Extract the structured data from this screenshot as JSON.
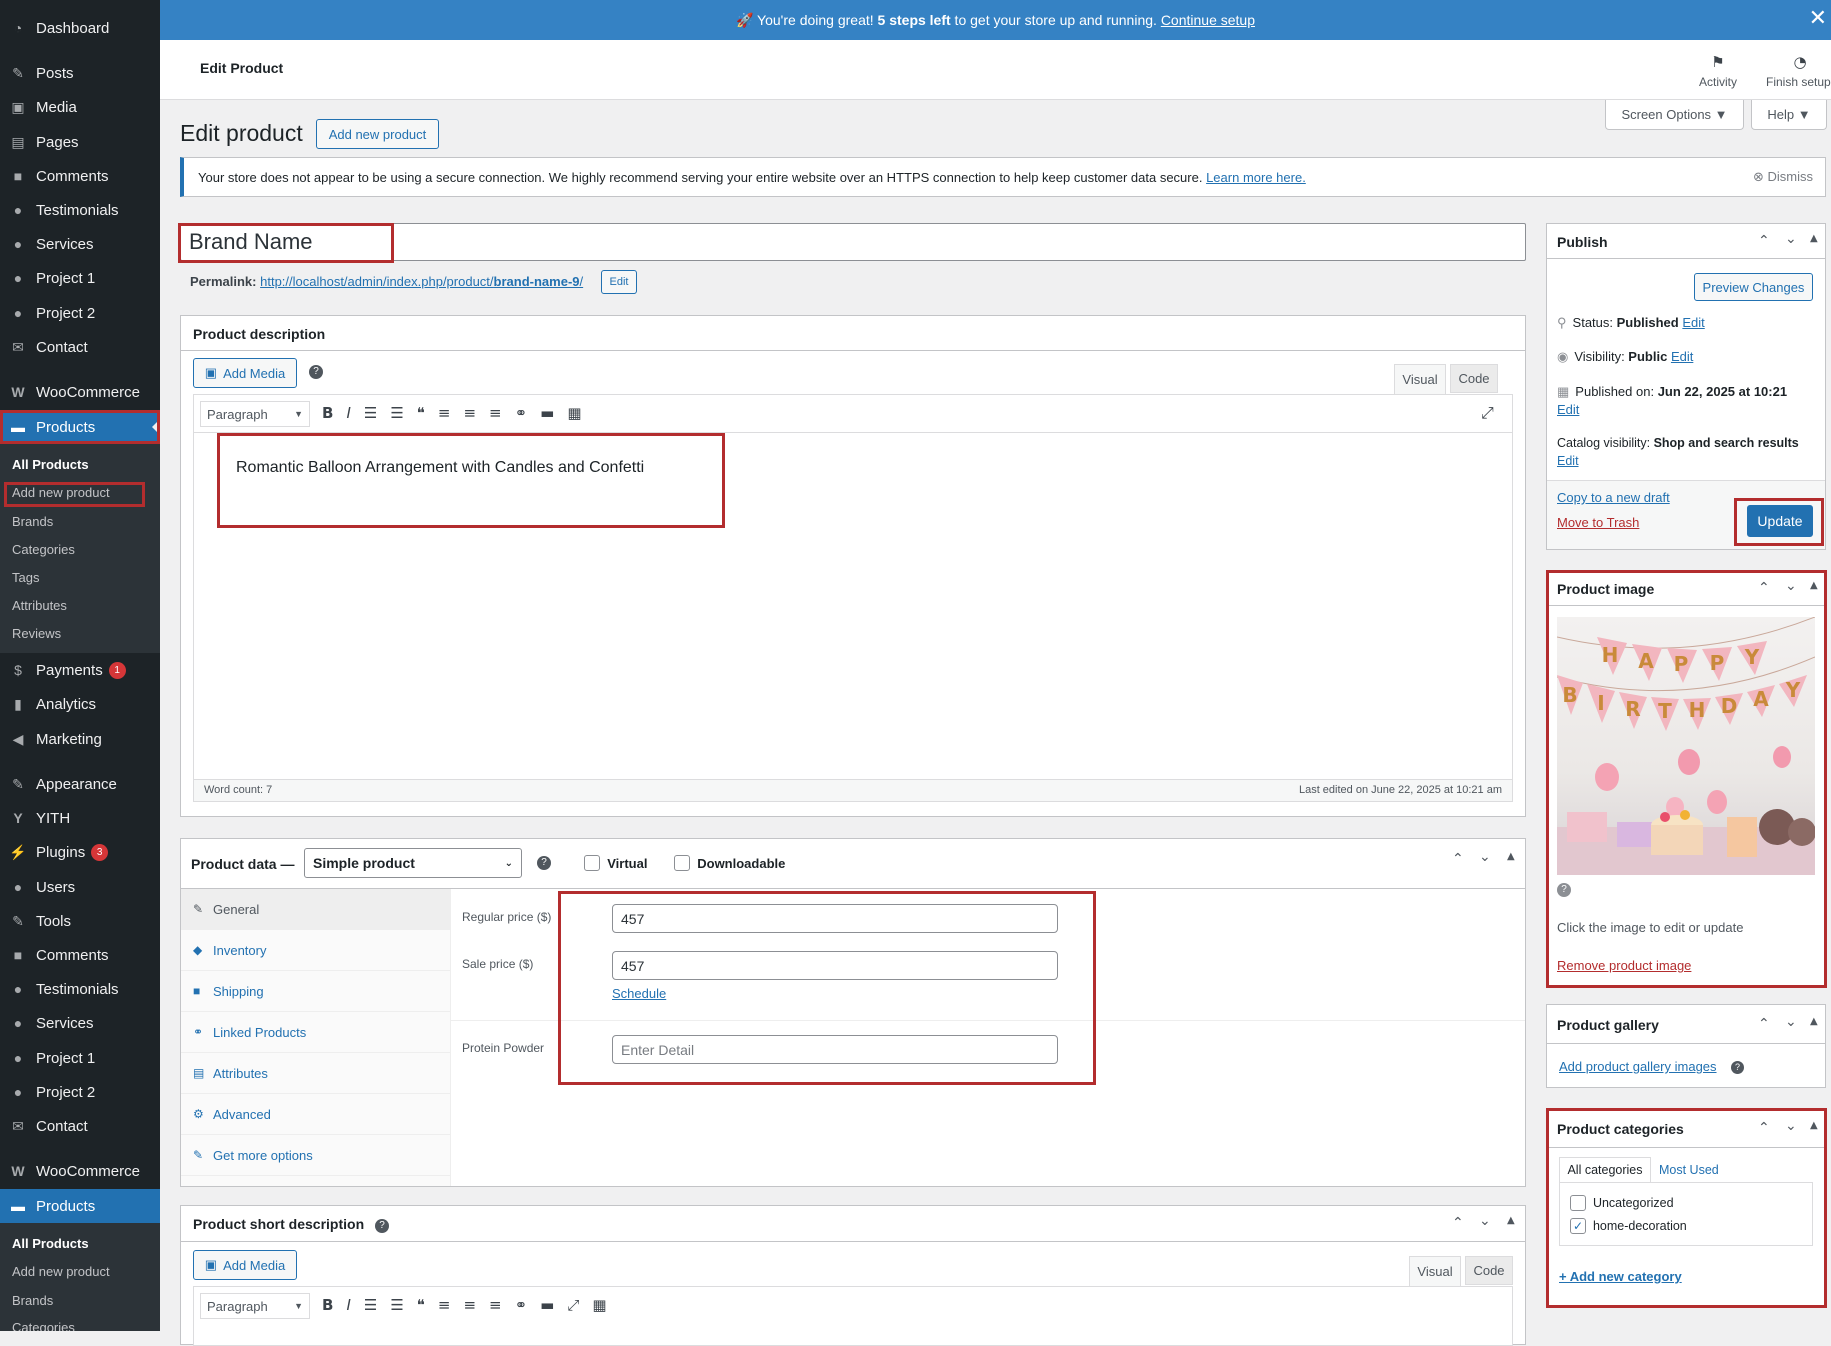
{
  "sidebar": {
    "dashboard": "Dashboard",
    "posts": "Posts",
    "media": "Media",
    "pages": "Pages",
    "comments": "Comments",
    "testimonials": "Testimonials",
    "services": "Services",
    "project1": "Project 1",
    "project2": "Project 2",
    "contact": "Contact",
    "woocommerce": "WooCommerce",
    "products": "Products",
    "sub": [
      "All Products",
      "Add new product",
      "Brands",
      "Categories",
      "Tags",
      "Attributes",
      "Reviews"
    ],
    "payments": "Payments",
    "payments_badge": "1",
    "analytics": "Analytics",
    "marketing": "Marketing",
    "appearance": "Appearance",
    "yith": "YITH",
    "plugins": "Plugins",
    "plugins_badge": "3",
    "users": "Users",
    "tools": "Tools"
  },
  "banner": {
    "prefix": "🚀 You're doing great! ",
    "bold": "5 steps left",
    "middle": " to get your store up and running. ",
    "link": "Continue setup"
  },
  "topbar": {
    "title": "Edit Product",
    "activity": "Activity",
    "finish_setup": "Finish setup",
    "screen_options": "Screen Options ▼",
    "help": "Help ▼"
  },
  "page": {
    "heading": "Edit product",
    "add_new": "Add new product",
    "notice": "Your store does not appear to be using a secure connection. We highly recommend serving your entire website over an HTTPS connection to help keep customer data secure.",
    "notice_link": "Learn more here.",
    "dismiss": "Dismiss",
    "title_value": "Brand Name",
    "permalink_label": "Permalink:",
    "permalink_url": "http://localhost/admin/index.php/product/",
    "permalink_slug": "brand-name-9",
    "permalink_end": "/",
    "permalink_edit": "Edit"
  },
  "description": {
    "heading": "Product description",
    "add_media": "Add Media",
    "tab_visual": "Visual",
    "tab_code": "Code",
    "format": "Paragraph",
    "content": "Romantic Balloon Arrangement with Candles and Confetti",
    "word_count": "Word count: 7",
    "last_edited": "Last edited on June 22, 2025 at 10:21 am"
  },
  "product_data": {
    "heading": "Product data —",
    "type": "Simple product",
    "virtual": "Virtual",
    "downloadable": "Downloadable",
    "tabs": [
      "General",
      "Inventory",
      "Shipping",
      "Linked Products",
      "Attributes",
      "Advanced",
      "Get more options"
    ],
    "regular_price_label": "Regular price ($)",
    "regular_price": "457",
    "sale_price_label": "Sale price ($)",
    "sale_price": "457",
    "schedule": "Schedule",
    "protein_label": "Protein Powder",
    "protein_placeholder": "Enter Detail"
  },
  "short_desc": {
    "heading": "Product short description",
    "add_media": "Add Media",
    "tab_visual": "Visual",
    "tab_code": "Code",
    "format": "Paragraph"
  },
  "publish": {
    "heading": "Publish",
    "preview": "Preview Changes",
    "status_label": "Status: ",
    "status": "Published",
    "visibility_label": "Visibility: ",
    "visibility": "Public",
    "published_label": "Published on: ",
    "published": "Jun 22, 2025 at 10:21",
    "catalog_label": "Catalog visibility: ",
    "catalog": "Shop and search results",
    "edit": "Edit",
    "copy": "Copy to a new draft",
    "trash": "Move to Trash",
    "update": "Update"
  },
  "product_image": {
    "heading": "Product image",
    "hint": "Click the image to edit or update",
    "remove": "Remove product image",
    "letters_top": "HAPPY",
    "letters_bottom": "BIRTHDAY"
  },
  "gallery": {
    "heading": "Product gallery",
    "add": "Add product gallery images"
  },
  "categories": {
    "heading": "Product categories",
    "tab_all": "All categories",
    "tab_used": "Most Used",
    "items": [
      "Uncategorized",
      "home-decoration"
    ],
    "add": "+ Add new category"
  },
  "colors": {
    "sidebar": "#1d2327",
    "accent": "#2271b1",
    "banner": "#3582c4",
    "highlight": "#b32d2e"
  }
}
